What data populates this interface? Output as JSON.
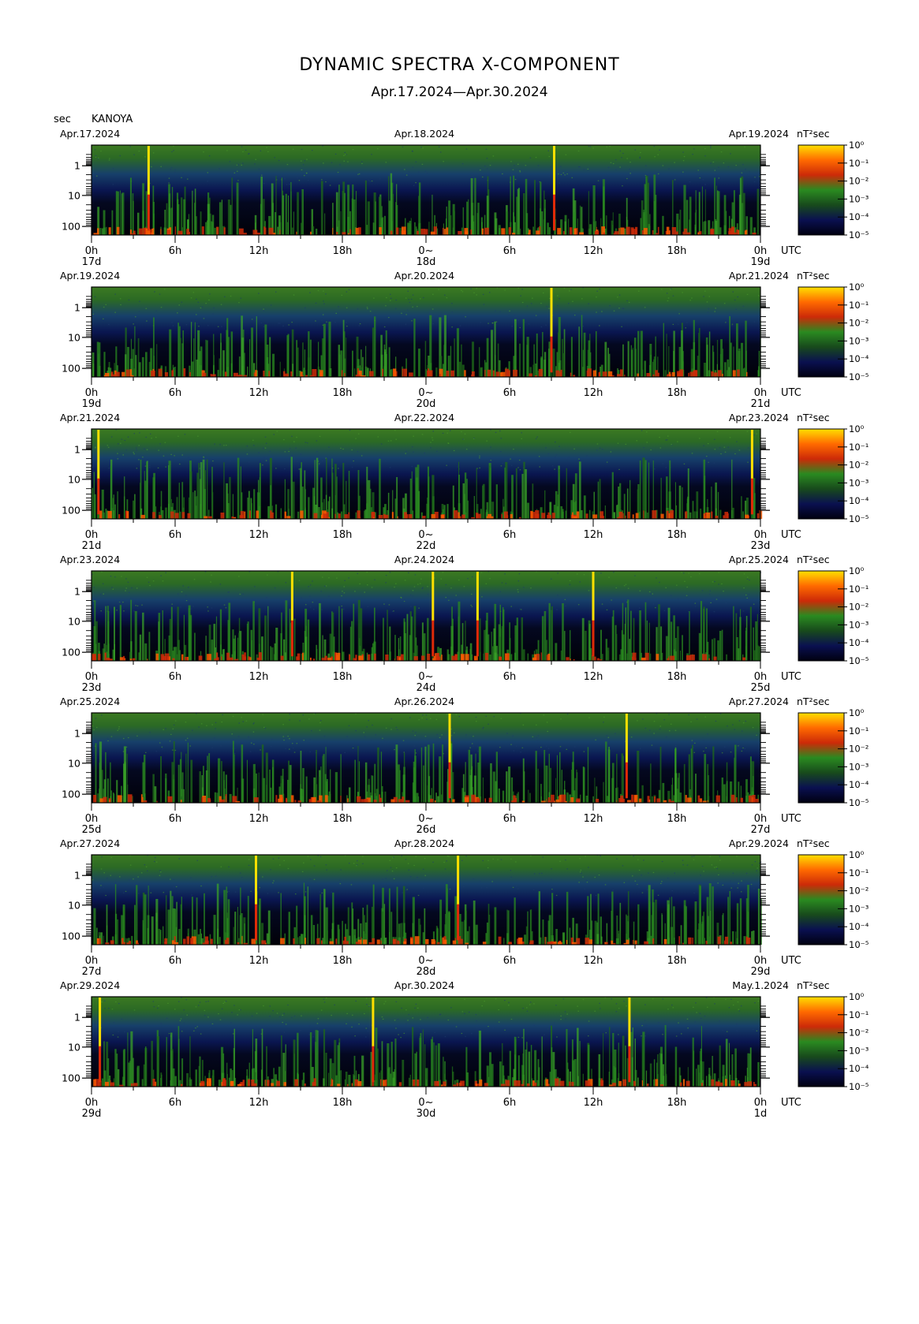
{
  "title": "DYNAMIC SPECTRA X-COMPONENT",
  "subtitle": "Apr.17.2024—Apr.30.2024",
  "y_unit_label": "sec",
  "station": "KANOYA",
  "colors": {
    "scale": [
      "#000010",
      "#0a1050",
      "#184a1c",
      "#2a8a20",
      "#cc2a08",
      "#ff6a00",
      "#ffe000"
    ],
    "frame": "#000000"
  },
  "chart_data": [
    {
      "type": "heatmap",
      "dates": {
        "left": "Apr.17.2024",
        "mid": "Apr.18.2024",
        "right": "Apr.19.2024"
      },
      "x_ticks": [
        "0h",
        "6h",
        "12h",
        "18h",
        "0~",
        "6h",
        "12h",
        "18h",
        "0h"
      ],
      "x_day_labels": [
        "17d",
        "18d",
        "19d"
      ],
      "x_unit": "UTC",
      "y_ticks": [
        "1",
        "10",
        "100"
      ],
      "colorbar_unit": "nT²sec",
      "colorbar_ticks": [
        "10⁰",
        "10⁻¹",
        "10⁻²",
        "10⁻³",
        "10⁻⁴",
        "10⁻⁵"
      ],
      "events_hours": [
        4.1,
        33.2
      ]
    },
    {
      "type": "heatmap",
      "dates": {
        "left": "Apr.19.2024",
        "mid": "Apr.20.2024",
        "right": "Apr.21.2024"
      },
      "x_ticks": [
        "0h",
        "6h",
        "12h",
        "18h",
        "0~",
        "6h",
        "12h",
        "18h",
        "0h"
      ],
      "x_day_labels": [
        "19d",
        "20d",
        "21d"
      ],
      "x_unit": "UTC",
      "y_ticks": [
        "1",
        "10",
        "100"
      ],
      "colorbar_unit": "nT²sec",
      "colorbar_ticks": [
        "10⁰",
        "10⁻¹",
        "10⁻²",
        "10⁻³",
        "10⁻⁴",
        "10⁻⁵"
      ],
      "events_hours": [
        33.0
      ]
    },
    {
      "type": "heatmap",
      "dates": {
        "left": "Apr.21.2024",
        "mid": "Apr.22.2024",
        "right": "Apr.23.2024"
      },
      "x_ticks": [
        "0h",
        "6h",
        "12h",
        "18h",
        "0~",
        "6h",
        "12h",
        "18h",
        "0h"
      ],
      "x_day_labels": [
        "21d",
        "22d",
        "23d"
      ],
      "x_unit": "UTC",
      "y_ticks": [
        "1",
        "10",
        "100"
      ],
      "colorbar_unit": "nT²sec",
      "colorbar_ticks": [
        "10⁰",
        "10⁻¹",
        "10⁻²",
        "10⁻³",
        "10⁻⁴",
        "10⁻⁵"
      ],
      "events_hours": [
        0.5,
        47.4
      ]
    },
    {
      "type": "heatmap",
      "dates": {
        "left": "Apr.23.2024",
        "mid": "Apr.24.2024",
        "right": "Apr.25.2024"
      },
      "x_ticks": [
        "0h",
        "6h",
        "12h",
        "18h",
        "0~",
        "6h",
        "12h",
        "18h",
        "0h"
      ],
      "x_day_labels": [
        "23d",
        "24d",
        "25d"
      ],
      "x_unit": "UTC",
      "y_ticks": [
        "1",
        "10",
        "100"
      ],
      "colorbar_unit": "nT²sec",
      "colorbar_ticks": [
        "10⁰",
        "10⁻¹",
        "10⁻²",
        "10⁻³",
        "10⁻⁴",
        "10⁻⁵"
      ],
      "events_hours": [
        14.4,
        24.5,
        27.7,
        36.0
      ]
    },
    {
      "type": "heatmap",
      "dates": {
        "left": "Apr.25.2024",
        "mid": "Apr.26.2024",
        "right": "Apr.27.2024"
      },
      "x_ticks": [
        "0h",
        "6h",
        "12h",
        "18h",
        "0~",
        "6h",
        "12h",
        "18h",
        "0h"
      ],
      "x_day_labels": [
        "25d",
        "26d",
        "27d"
      ],
      "x_unit": "UTC",
      "y_ticks": [
        "1",
        "10",
        "100"
      ],
      "colorbar_unit": "nT²sec",
      "colorbar_ticks": [
        "10⁰",
        "10⁻¹",
        "10⁻²",
        "10⁻³",
        "10⁻⁴",
        "10⁻⁵"
      ],
      "events_hours": [
        25.7,
        38.4
      ]
    },
    {
      "type": "heatmap",
      "dates": {
        "left": "Apr.27.2024",
        "mid": "Apr.28.2024",
        "right": "Apr.29.2024"
      },
      "x_ticks": [
        "0h",
        "6h",
        "12h",
        "18h",
        "0~",
        "6h",
        "12h",
        "18h",
        "0h"
      ],
      "x_day_labels": [
        "27d",
        "28d",
        "29d"
      ],
      "x_unit": "UTC",
      "y_ticks": [
        "1",
        "10",
        "100"
      ],
      "colorbar_unit": "nT²sec",
      "colorbar_ticks": [
        "10⁰",
        "10⁻¹",
        "10⁻²",
        "10⁻³",
        "10⁻⁴",
        "10⁻⁵"
      ],
      "events_hours": [
        11.8,
        26.3
      ]
    },
    {
      "type": "heatmap",
      "dates": {
        "left": "Apr.29.2024",
        "mid": "Apr.30.2024",
        "right": "May.1.2024"
      },
      "x_ticks": [
        "0h",
        "6h",
        "12h",
        "18h",
        "0~",
        "6h",
        "12h",
        "18h",
        "0h"
      ],
      "x_day_labels": [
        "29d",
        "30d",
        "1d"
      ],
      "x_unit": "UTC",
      "y_ticks": [
        "1",
        "10",
        "100"
      ],
      "colorbar_unit": "nT²sec",
      "colorbar_ticks": [
        "10⁰",
        "10⁻¹",
        "10⁻²",
        "10⁻³",
        "10⁻⁴",
        "10⁻⁵"
      ],
      "events_hours": [
        0.6,
        20.2,
        38.6
      ]
    }
  ]
}
